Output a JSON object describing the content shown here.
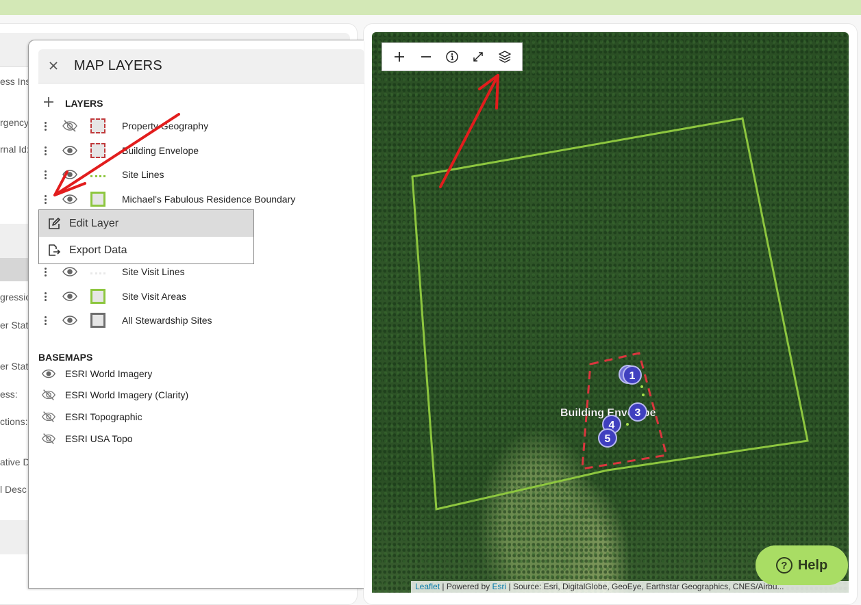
{
  "background_form": {
    "labels": [
      "ess Inst",
      "rgency",
      "rnal Id:",
      "gressio",
      "er State",
      "er State",
      "ess:",
      "ctions:",
      "ative D",
      "l Desc"
    ]
  },
  "layers_panel": {
    "title": "MAP LAYERS",
    "close_icon": "close-icon",
    "layers_section_title": "LAYERS",
    "basemaps_section_title": "BASEMAPS",
    "layers": [
      {
        "label": "Property Geography",
        "visible": false,
        "swatch": "dashed-red-box"
      },
      {
        "label": "Building Envelope",
        "visible": true,
        "swatch": "dashed-red-box"
      },
      {
        "label": "Site Lines",
        "visible": true,
        "swatch": "dotted-green-line"
      },
      {
        "label": "Michael's Fabulous Residence Boundary",
        "visible": true,
        "swatch": "green-box"
      },
      {
        "label": "Site Visit Lines",
        "visible": true,
        "swatch": "dotted-light-line"
      },
      {
        "label": "Site Visit Areas",
        "visible": true,
        "swatch": "green-box"
      },
      {
        "label": "All Stewardship Sites",
        "visible": true,
        "swatch": "gray-box"
      }
    ],
    "context_menu": {
      "items": [
        {
          "label": "Edit Layer",
          "icon": "edit-icon",
          "highlighted": true
        },
        {
          "label": "Export Data",
          "icon": "export-icon",
          "highlighted": false
        }
      ]
    },
    "basemaps": [
      {
        "label": "ESRI World Imagery",
        "visible": true
      },
      {
        "label": "ESRI World Imagery (Clarity)",
        "visible": false
      },
      {
        "label": "ESRI Topographic",
        "visible": false
      },
      {
        "label": "ESRI USA Topo",
        "visible": false
      }
    ]
  },
  "map": {
    "controls": [
      {
        "name": "zoom-in",
        "glyph": "+"
      },
      {
        "name": "zoom-out",
        "glyph": "−"
      },
      {
        "name": "info",
        "glyph": "ⓘ"
      },
      {
        "name": "fullscreen",
        "glyph": "⤢"
      },
      {
        "name": "layers",
        "glyph": "layers"
      }
    ],
    "polygon_label": "Building Envelope",
    "markers": [
      "1",
      "3",
      "4",
      "5"
    ],
    "attribution": {
      "leaflet": "Leaflet",
      "sep1": " | Powered by ",
      "esri": "Esri",
      "source": " | Source: Esri, DigitalGlobe, GeoEye, Earthstar Geographics, CNES/Airbu..."
    }
  },
  "help_button": {
    "label": "Help"
  },
  "colors": {
    "topbar": "#d3e8b6",
    "boundary_green": "#8dc63f",
    "envelope_red": "#d9363e",
    "marker_blue": "#3f3fbf",
    "help_green": "#a9dd64",
    "annotation_red": "#e21d1d"
  }
}
